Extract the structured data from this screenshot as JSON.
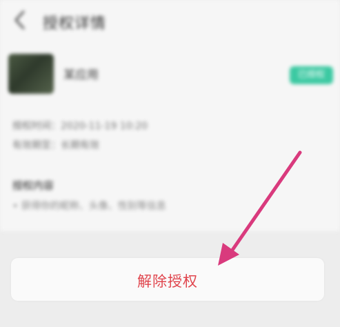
{
  "header": {
    "title": "授权详情"
  },
  "app": {
    "name": "某应用",
    "status": "已授权"
  },
  "details": {
    "auth_time": "授权时间：2020-11-19 10:20",
    "valid_period": "有效期至：长期有效"
  },
  "permissions": {
    "title": "授权内容",
    "item": "• 获得你的昵称、头像、性别等信息"
  },
  "actions": {
    "revoke_label": "解除授权"
  },
  "colors": {
    "accent_red": "#e0454d",
    "arrow_pink": "#d93a7d",
    "status_green": "#3cc9a2"
  }
}
